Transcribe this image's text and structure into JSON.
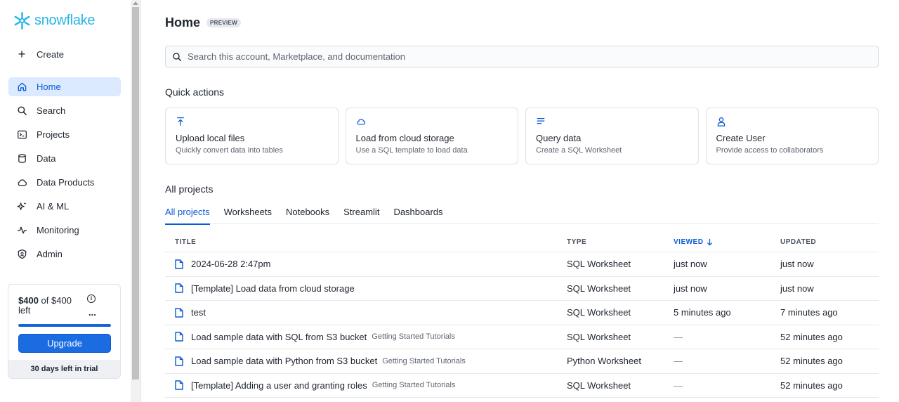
{
  "brand": {
    "name": "snowflake",
    "color": "#29b5e8",
    "accent": "#0b5ad4"
  },
  "sidebar": {
    "create_label": "Create",
    "items": [
      {
        "label": "Home",
        "icon": "home-icon",
        "active": true
      },
      {
        "label": "Search",
        "icon": "search-icon"
      },
      {
        "label": "Projects",
        "icon": "terminal-icon"
      },
      {
        "label": "Data",
        "icon": "database-icon"
      },
      {
        "label": "Data Products",
        "icon": "cloud-icon"
      },
      {
        "label": "AI & ML",
        "icon": "sparkle-icon"
      },
      {
        "label": "Monitoring",
        "icon": "activity-icon"
      },
      {
        "label": "Admin",
        "icon": "shield-icon"
      }
    ],
    "trial": {
      "amount": "$400",
      "of_text": "of $400",
      "left_text": "left",
      "info_glyph": "i",
      "more_glyph": "...",
      "credit_remaining_fraction": 1.0,
      "upgrade_label": "Upgrade",
      "footer": "30 days left in trial"
    }
  },
  "header": {
    "title": "Home",
    "badge": "PREVIEW"
  },
  "search": {
    "placeholder": "Search this account, Marketplace, and documentation"
  },
  "quick_actions": {
    "title": "Quick actions",
    "cards": [
      {
        "icon": "upload-icon",
        "title": "Upload local files",
        "subtitle": "Quickly convert data into tables"
      },
      {
        "icon": "cloud-icon",
        "title": "Load from cloud storage",
        "subtitle": "Use a SQL template to load data"
      },
      {
        "icon": "lines-icon",
        "title": "Query data",
        "subtitle": "Create a SQL Worksheet"
      },
      {
        "icon": "user-icon",
        "title": "Create User",
        "subtitle": "Provide access to collaborators"
      }
    ]
  },
  "projects": {
    "title": "All projects",
    "tabs": [
      "All projects",
      "Worksheets",
      "Notebooks",
      "Streamlit",
      "Dashboards"
    ],
    "active_tab": 0,
    "columns": {
      "title": "TITLE",
      "type": "TYPE",
      "viewed": "VIEWED",
      "updated": "UPDATED"
    },
    "rows": [
      {
        "title": "2024-06-28 2:47pm",
        "tag": "",
        "type": "SQL Worksheet",
        "viewed": "just now",
        "updated": "just now"
      },
      {
        "title": "[Template] Load data from cloud storage",
        "tag": "",
        "type": "SQL Worksheet",
        "viewed": "just now",
        "updated": "just now"
      },
      {
        "title": "test",
        "tag": "",
        "type": "SQL Worksheet",
        "viewed": "5 minutes ago",
        "updated": "7 minutes ago"
      },
      {
        "title": "Load sample data with SQL from S3 bucket",
        "tag": "Getting Started Tutorials",
        "type": "SQL Worksheet",
        "viewed": "—",
        "updated": "52 minutes ago"
      },
      {
        "title": "Load sample data with Python from S3 bucket",
        "tag": "Getting Started Tutorials",
        "type": "Python Worksheet",
        "viewed": "—",
        "updated": "52 minutes ago"
      },
      {
        "title": "[Template] Adding a user and granting roles",
        "tag": "Getting Started Tutorials",
        "type": "SQL Worksheet",
        "viewed": "—",
        "updated": "52 minutes ago"
      }
    ]
  }
}
